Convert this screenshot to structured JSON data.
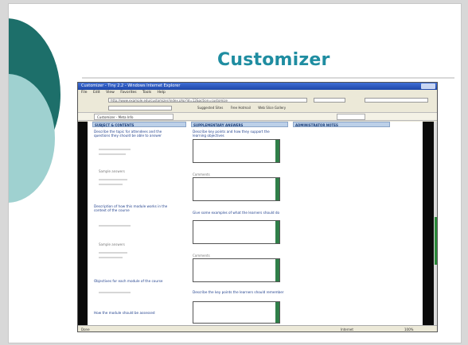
{
  "slide": {
    "title": "Customizer"
  },
  "browser": {
    "window_title": "Customizer - Tiny 2.2 - Windows Internet Explorer",
    "menu": [
      "File",
      "Edit",
      "View",
      "Favorites",
      "Tools",
      "Help"
    ],
    "address": "http://www.example.edu/customizer/index.php?id=12&action=customize",
    "tab_label": "Customizer - Meta Info",
    "links": [
      "Suggested Sites",
      "Free Hotmail",
      "Web Slice Gallery"
    ],
    "status_text": "Done",
    "status_zone": "Internet",
    "zoom": "100%"
  },
  "columns": [
    {
      "header": "Subject & Contents"
    },
    {
      "header": "Supplementary Answers"
    },
    {
      "header": "Administrator Notes"
    }
  ],
  "questions_left": [
    "Describe the topic for attendees and the questions they should be able to answer",
    "Sample answers",
    "Description of how this module works in the context of the course",
    "Sample answers",
    "Objectives for each module of the course",
    "How the module should be assessed"
  ],
  "questions_mid": [
    "Describe key points and how they support the learning objectives",
    "Comments",
    "Give some examples of what the learners should do",
    "Comments",
    "Describe the key points the learners should remember"
  ]
}
